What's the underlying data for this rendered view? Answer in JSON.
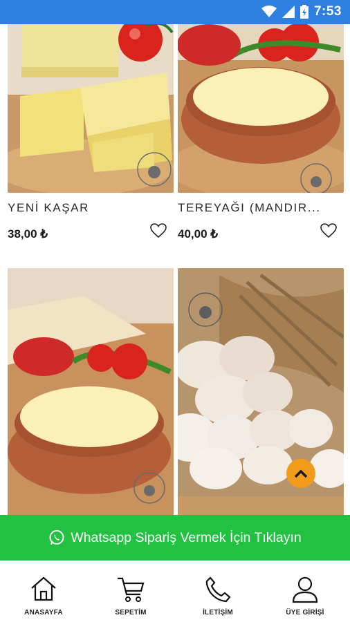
{
  "status_bar": {
    "time": "7:53"
  },
  "products": [
    {
      "name": "YENİ KAŞAR",
      "price": "38,00 ₺"
    },
    {
      "name": "TEREYAĞI (MANDIR...",
      "price": "40,00 ₺"
    },
    {
      "name": "",
      "price": ""
    },
    {
      "name": "",
      "price": ""
    }
  ],
  "whatsapp": {
    "label": "Whatsapp Sipariş Vermek İçin Tıklayın",
    "color": "#22c141"
  },
  "bottom_nav": [
    {
      "label": "ANASAYFA",
      "icon": "home-icon"
    },
    {
      "label": "SEPETİM",
      "icon": "cart-icon"
    },
    {
      "label": "İLETİŞİM",
      "icon": "phone-icon"
    },
    {
      "label": "ÜYE GİRİŞİ",
      "icon": "user-icon"
    }
  ],
  "colors": {
    "status_bar": "#2f7fe1",
    "scroll_top": "#f39b1c"
  }
}
